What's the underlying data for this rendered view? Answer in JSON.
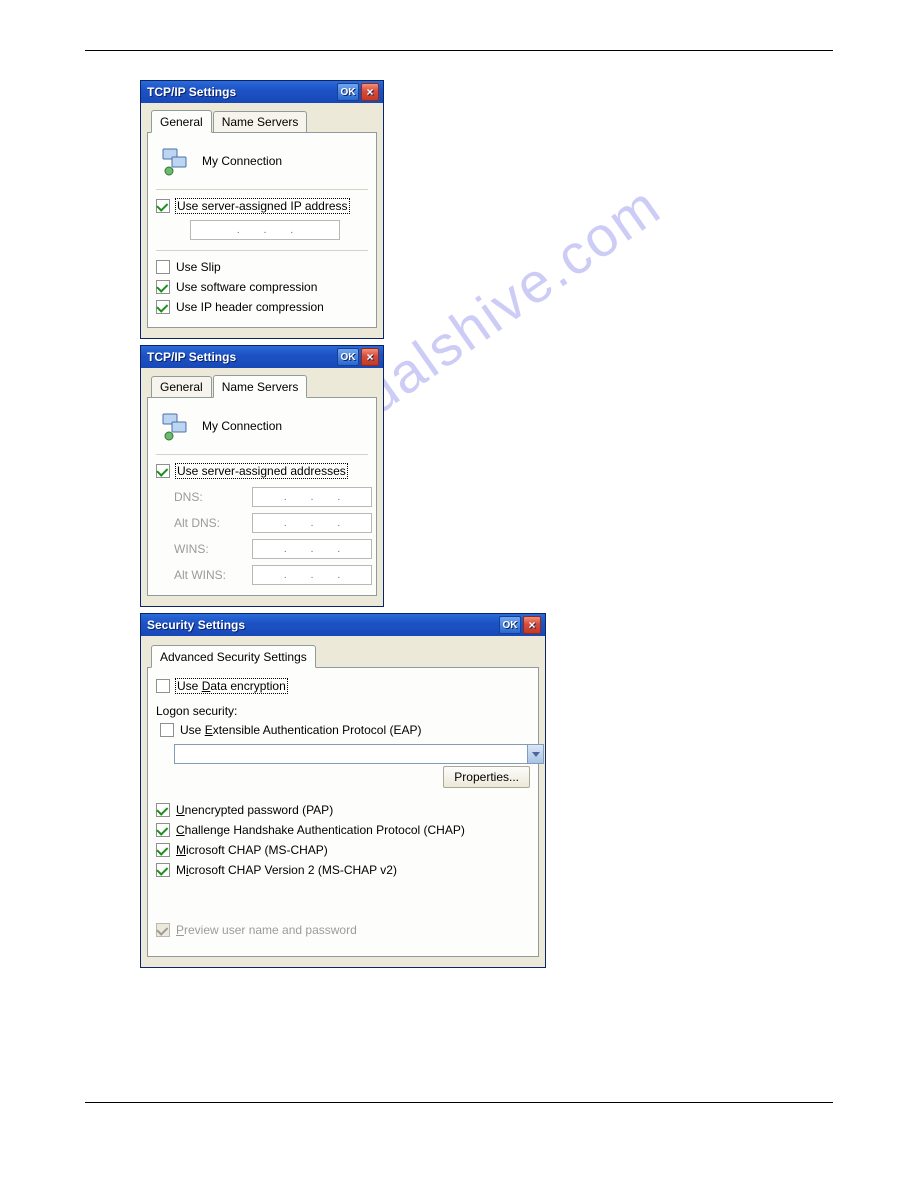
{
  "watermark": "manualshive.com",
  "dialog1": {
    "title": "TCP/IP Settings",
    "ok": "OK",
    "tabs": {
      "general": "General",
      "nameservers": "Name Servers"
    },
    "connection": "My Connection",
    "use_server_ip": "Use server-assigned IP address",
    "use_slip": "Use Slip",
    "use_sw_comp": "Use software compression",
    "use_ip_hdr_comp": "Use IP header compression"
  },
  "dialog2": {
    "title": "TCP/IP Settings",
    "ok": "OK",
    "tabs": {
      "general": "General",
      "nameservers": "Name Servers"
    },
    "connection": "My Connection",
    "use_server_addr": "Use server-assigned addresses",
    "dns": "DNS:",
    "alt_dns": "Alt DNS:",
    "wins": "WINS:",
    "alt_wins": "Alt WINS:"
  },
  "dialog3": {
    "title": "Security Settings",
    "ok": "OK",
    "tab": "Advanced Security Settings",
    "use_data_enc": "Use Data encryption",
    "logon_security": "Logon security:",
    "use_eap": "Use Extensible Authentication Protocol (EAP)",
    "properties": "Properties...",
    "pap": "Unencrypted password (PAP)",
    "chap": "Challenge Handshake Authentication Protocol (CHAP)",
    "mschap": "Microsoft CHAP (MS-CHAP)",
    "mschap2": "Microsoft CHAP Version 2 (MS-CHAP v2)",
    "preview": "Preview user name and password"
  }
}
